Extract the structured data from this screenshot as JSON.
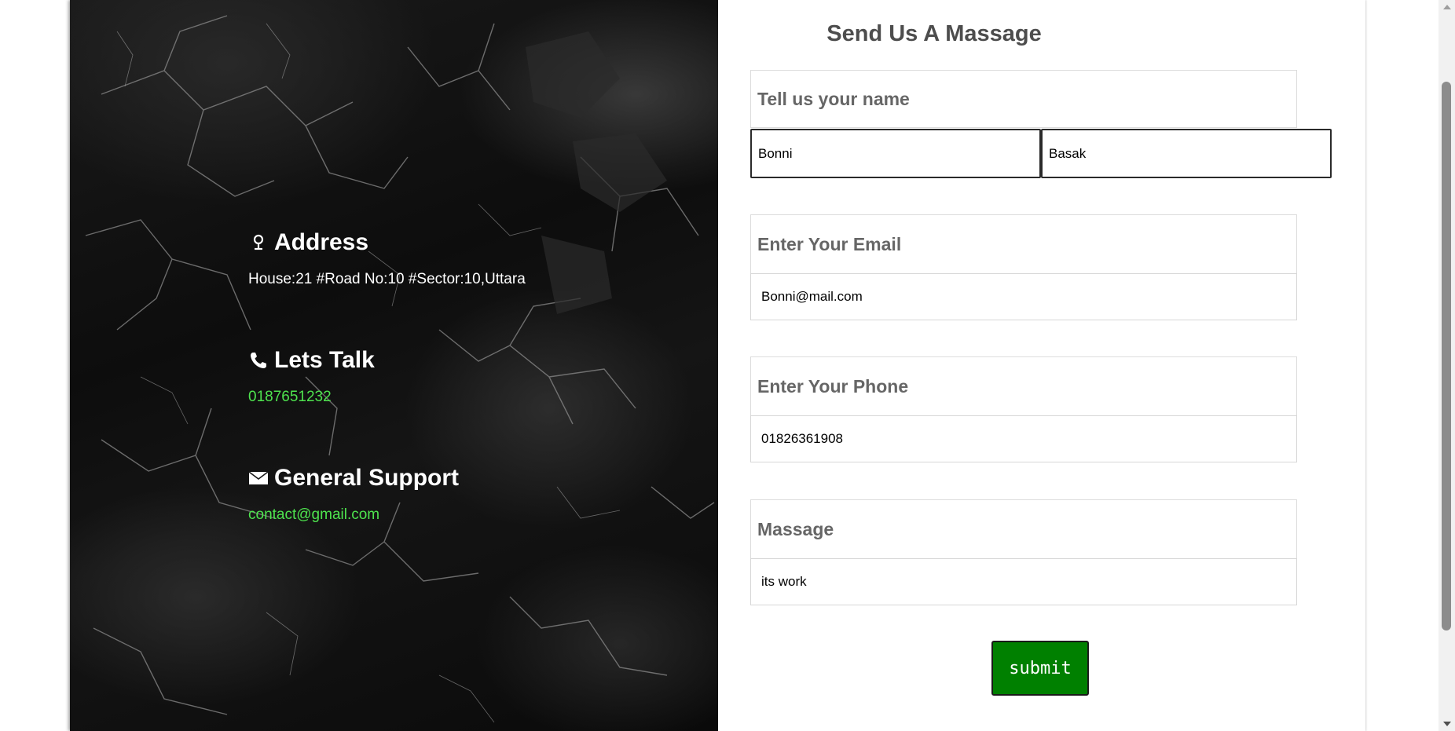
{
  "info": {
    "address": {
      "icon": "map-pin-icon",
      "title": "Address",
      "text": "House:21 #Road No:10 #Sector:10,Uttara"
    },
    "talk": {
      "icon": "phone-icon",
      "title": "Lets Talk",
      "text": "0187651232"
    },
    "support": {
      "icon": "envelope-icon",
      "title": "General Support",
      "text": "contact@gmail.com"
    }
  },
  "form": {
    "title": "Send Us A Massage",
    "name_label": "Tell us your name",
    "first_name": "Bonni",
    "last_name": "Basak",
    "email_label": "Enter Your Email",
    "email": "Bonni@mail.com",
    "phone_label": "Enter Your Phone",
    "phone": "01826361908",
    "message_label": "Massage",
    "message": "its work",
    "submit_label": "submit"
  },
  "colors": {
    "accent_green": "#4ee34e",
    "submit_bg": "#008000",
    "title_gray": "#4d4d4d",
    "label_gray": "#666666"
  }
}
